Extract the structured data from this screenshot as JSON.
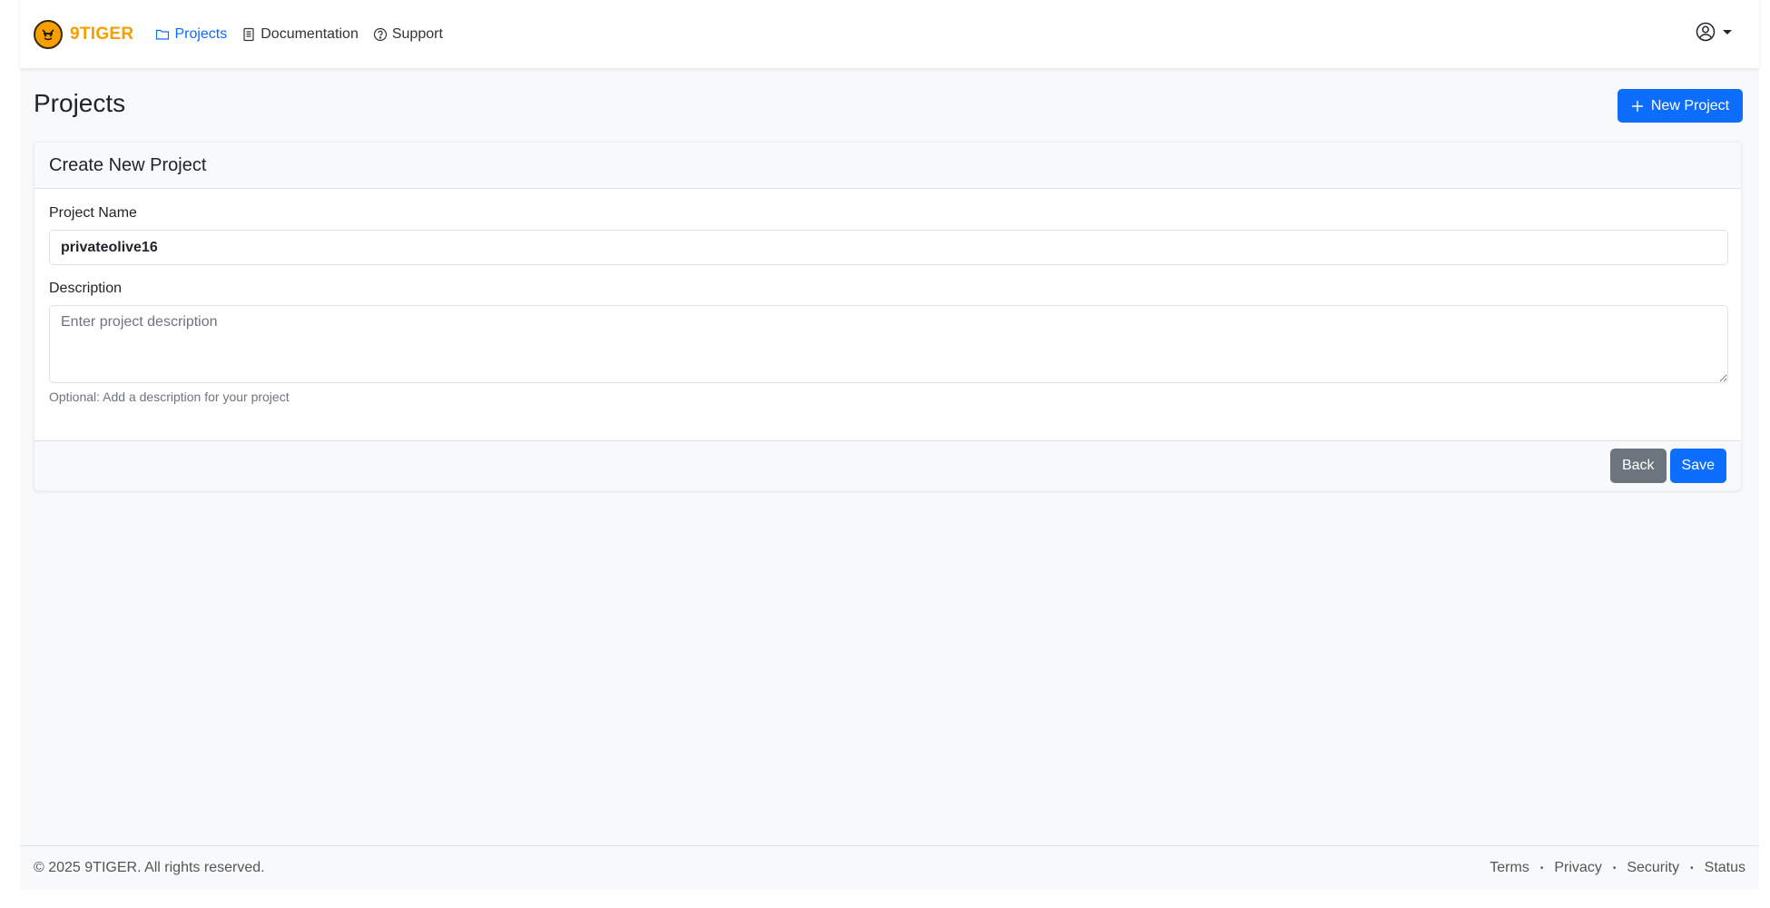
{
  "brand": {
    "name": "9TIGER",
    "logo_icon": "tiger-face-icon",
    "color": "#f59f00"
  },
  "nav": {
    "items": [
      {
        "label": "Projects",
        "icon": "folder-icon",
        "active": true
      },
      {
        "label": "Documentation",
        "icon": "document-icon",
        "active": false
      },
      {
        "label": "Support",
        "icon": "question-circle-icon",
        "active": false
      }
    ],
    "user_icon": "user-circle-icon"
  },
  "page": {
    "title": "Projects",
    "new_project_label": "New Project"
  },
  "form": {
    "card_title": "Create New Project",
    "project_name_label": "Project Name",
    "project_name_value": "privateolive16",
    "description_label": "Description",
    "description_placeholder": "Enter project description",
    "description_value": "",
    "description_help": "Optional: Add a description for your project",
    "back_label": "Back",
    "save_label": "Save"
  },
  "footer": {
    "copyright": "© 2025 9TIGER. All rights reserved.",
    "links": [
      "Terms",
      "Privacy",
      "Security",
      "Status"
    ],
    "separator": "•"
  },
  "colors": {
    "primary": "#0d6efd",
    "secondary": "#6c757d",
    "background": "#f8f9fa"
  }
}
